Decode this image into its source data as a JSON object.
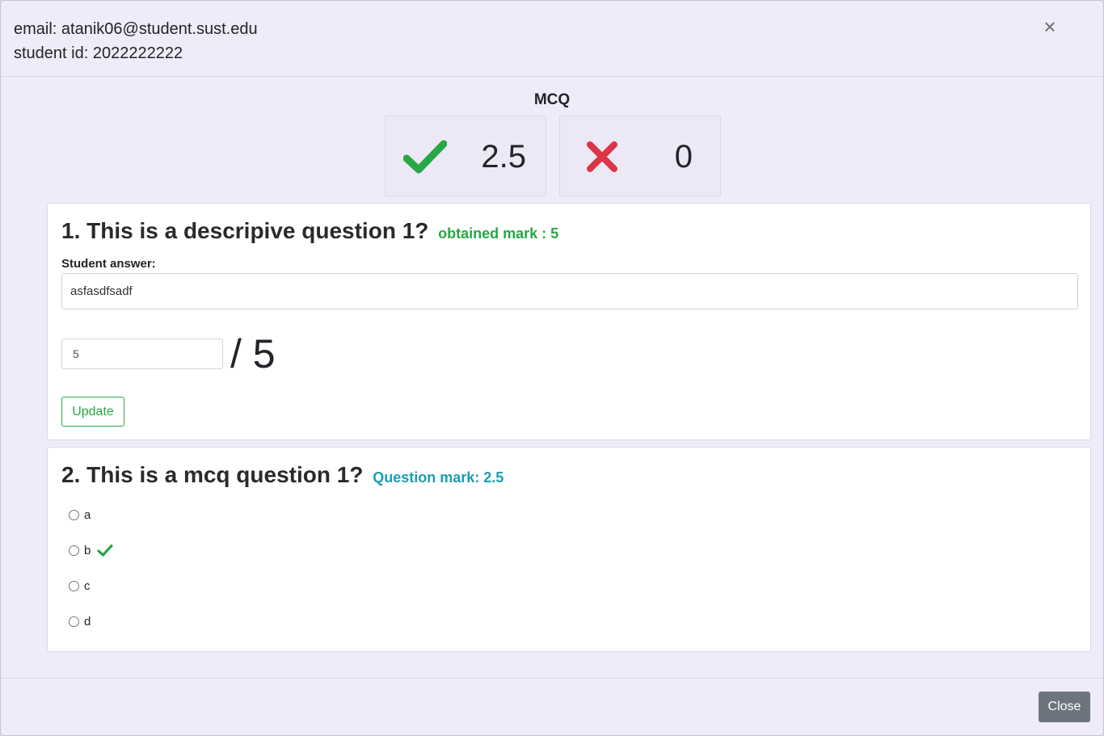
{
  "header": {
    "email_line": "email: atanik06@student.sust.edu",
    "student_id_line": "student id: 2022222222",
    "close_symbol": "×"
  },
  "mcq_summary": {
    "title": "MCQ",
    "correct_value": "2.5",
    "wrong_value": "0",
    "correct_icon": "check-icon",
    "wrong_icon": "cross-icon",
    "correct_color": "#28a745",
    "wrong_color": "#dc3545"
  },
  "questions": [
    {
      "title": "1. This is a descripive question 1?",
      "badge": "obtained mark : 5",
      "answer_label": "Student answer:",
      "answer_text": "asfasdfsadf",
      "mark_value": "5",
      "mark_total": "/ 5",
      "update_label": "Update"
    },
    {
      "title": "2. This is a mcq question 1?",
      "badge": "Question mark: 2.5",
      "options": [
        {
          "label": "a",
          "correct": false
        },
        {
          "label": "b",
          "correct": true
        },
        {
          "label": "c",
          "correct": false
        },
        {
          "label": "d",
          "correct": false
        }
      ]
    }
  ],
  "footer": {
    "close_label": "Close"
  }
}
